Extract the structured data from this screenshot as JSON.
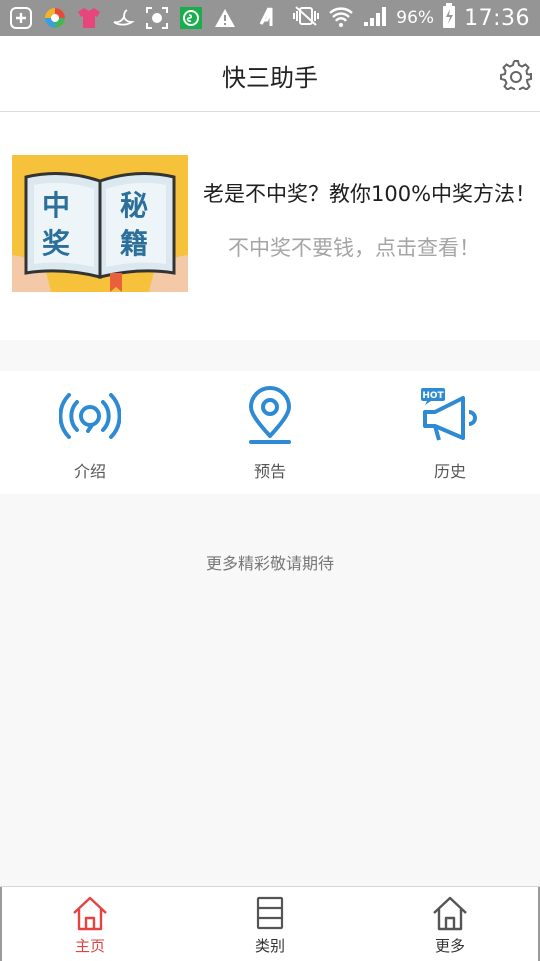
{
  "status_bar": {
    "battery_percent": "96%",
    "time": "17:36",
    "icons": [
      "add-icon",
      "colorful-app-icon",
      "shirt-icon",
      "bird-icon",
      "focus-icon",
      "wechat-icon",
      "warning-icon",
      "nfc-icon",
      "vibrate-icon",
      "wifi-icon",
      "signal-icon",
      "battery-icon"
    ]
  },
  "header": {
    "title": "快三助手",
    "settings_icon": "gear-icon"
  },
  "banner": {
    "image_text_1": "中",
    "image_text_2": "奖",
    "image_text_3": "秘",
    "image_text_4": "籍",
    "headline": "老是不中奖？教你100%中奖方法！",
    "subline": "不中奖不要钱，点击查看！"
  },
  "features": [
    {
      "label": "介绍",
      "icon": "broadcast-icon"
    },
    {
      "label": "预告",
      "icon": "location-pin-icon"
    },
    {
      "label": "历史",
      "icon": "megaphone-hot-icon",
      "badge": "HOT"
    }
  ],
  "coming_soon": "更多精彩敬请期待",
  "tabbar": {
    "tabs": [
      {
        "label": "主页",
        "icon": "home-icon",
        "active": true
      },
      {
        "label": "类别",
        "icon": "list-icon",
        "active": false
      },
      {
        "label": "更多",
        "icon": "home-outline-icon",
        "active": false
      }
    ]
  },
  "colors": {
    "accent_blue": "#2e8bd3",
    "active_red": "#e64340",
    "banner_yellow": "#f6c13b"
  }
}
